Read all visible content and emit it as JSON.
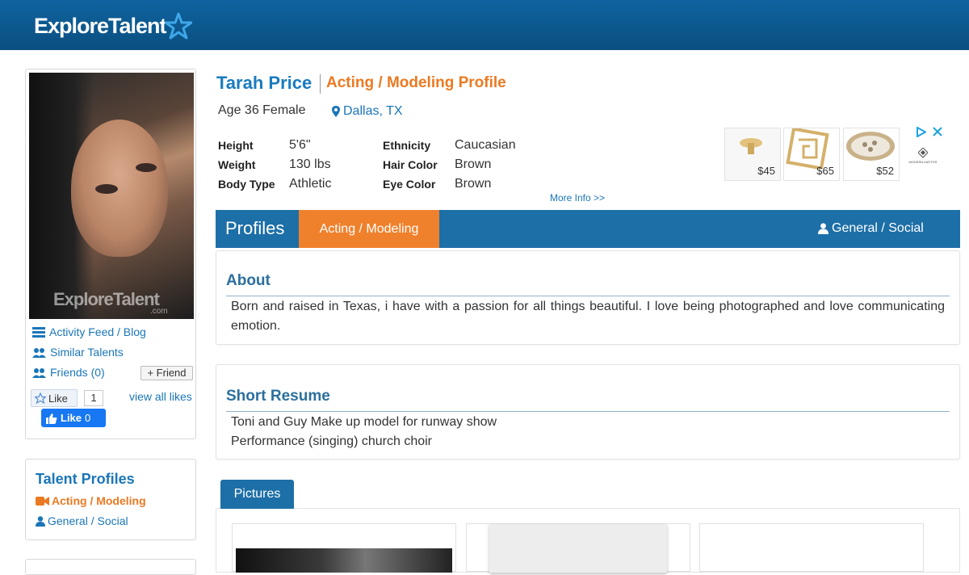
{
  "site": {
    "logo_text": "ExploreTalent"
  },
  "profile": {
    "name": "Tarah Price",
    "profile_type": "Acting / Modeling Profile",
    "age_gender": "Age 36 Female",
    "location": "Dallas, TX",
    "stats": [
      {
        "label": "Height",
        "value": "5'6\""
      },
      {
        "label": "Weight",
        "value": "130 lbs"
      },
      {
        "label": "Body Type",
        "value": "Athletic"
      },
      {
        "label": "Ethnicity",
        "value": "Caucasian"
      },
      {
        "label": "Hair Color",
        "value": "Brown"
      },
      {
        "label": "Eye Color",
        "value": "Brown"
      }
    ],
    "more_info": "More Info >>"
  },
  "photo": {
    "watermark": "ExploreTalent",
    "watermark_sub": ".com"
  },
  "sidebar": {
    "activity_feed": "Activity Feed / Blog",
    "similar_talents": "Similar Talents",
    "friends": "Friends (0)",
    "add_friend": "+ Friend",
    "like_label": "Like",
    "like_count": "1",
    "view_all_likes": "view all likes",
    "fb_like_label": "Like",
    "fb_like_count": "0"
  },
  "talent_profiles": {
    "title": "Talent Profiles",
    "items": [
      "Acting / Modeling",
      "General / Social"
    ],
    "colors": {
      "active": "#ea7a22",
      "inactive": "#1a76b8"
    }
  },
  "ad": {
    "prices": [
      "$45",
      "$65",
      "$52"
    ],
    "brand": "MODERN MATTER"
  },
  "tabs": {
    "profiles_label": "Profiles",
    "acting_label": "Acting / Modeling",
    "general_label": "General / Social"
  },
  "about": {
    "title": "About",
    "text": "Born and raised in Texas, i have with a passion for all things beautiful. I love being photographed and love communicating emotion."
  },
  "resume": {
    "title": "Short Resume",
    "lines": [
      "Toni and Guy Make up model for runway show",
      "Performance (singing) church choir"
    ]
  },
  "pictures": {
    "tab_label": "Pictures"
  },
  "colors": {
    "header": "#0f63a0",
    "accent_orange": "#f0812c",
    "link_blue": "#1a76b8"
  }
}
